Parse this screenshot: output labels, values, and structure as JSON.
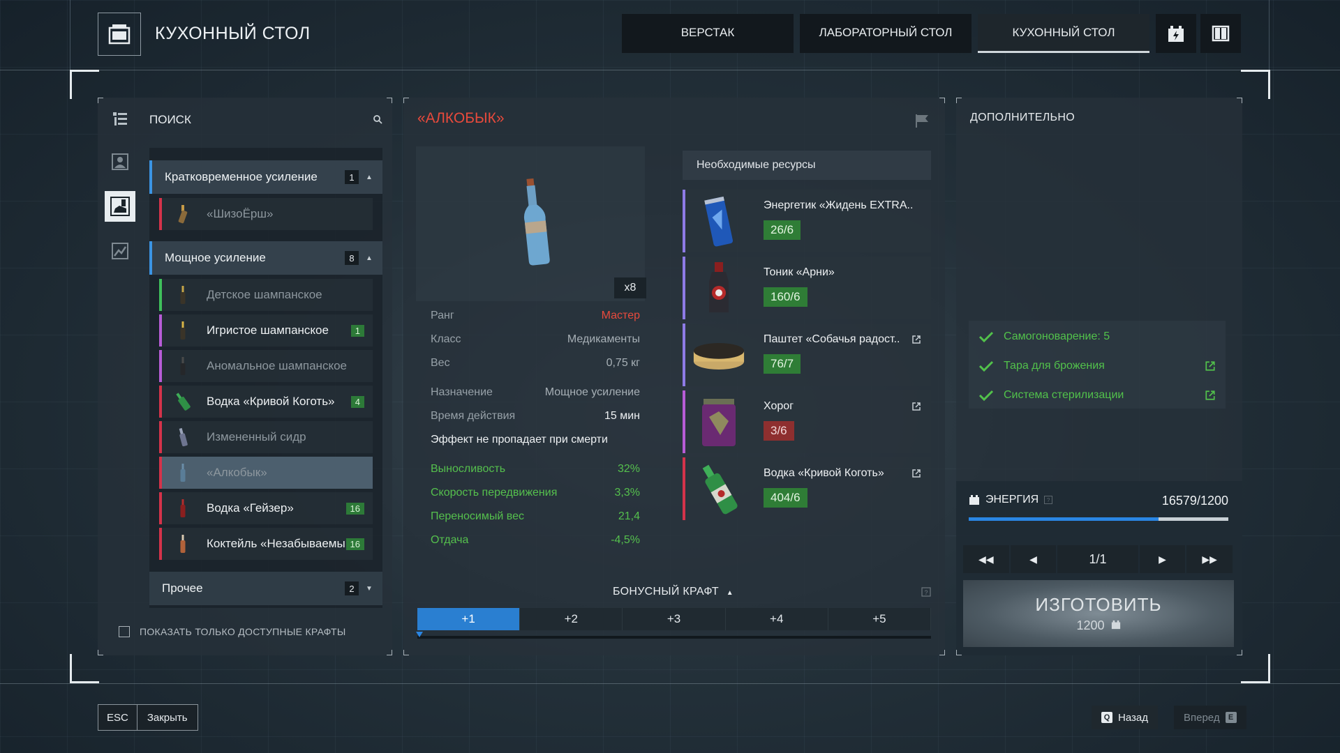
{
  "header": {
    "title": "КУХОННЫЙ СТОЛ",
    "tabs": [
      {
        "label": "ВЕРСТАК",
        "active": false
      },
      {
        "label": "ЛАБОРАТОРНЫЙ СТОЛ",
        "active": false
      },
      {
        "label": "КУХОННЫЙ СТОЛ",
        "active": true
      }
    ],
    "icons": [
      "energy-cell-icon",
      "book-icon"
    ]
  },
  "sidebar": {
    "search_label": "ПОИСК",
    "rail_icons": [
      "list-icon",
      "portrait-icon",
      "bottle-icon",
      "chart-icon"
    ],
    "categories": [
      {
        "label": "Кратковременное усиление",
        "count": "1",
        "expanded": true,
        "items": [
          {
            "name": "«ШизоЁрш»",
            "available": false,
            "qty": "",
            "color": "#d4334a"
          }
        ]
      },
      {
        "label": "Мощное усиление",
        "count": "8",
        "expanded": true,
        "items": [
          {
            "name": "Детское шампанское",
            "available": false,
            "qty": "",
            "color": "#3fbf5b"
          },
          {
            "name": "Игристое шампанское",
            "available": true,
            "qty": "1",
            "color": "#b75cd6"
          },
          {
            "name": "Аномальное шампанское",
            "available": false,
            "qty": "",
            "color": "#b75cd6"
          },
          {
            "name": "Водка «Кривой Коготь»",
            "available": true,
            "qty": "4",
            "color": "#d4334a"
          },
          {
            "name": "Измененный сидр",
            "available": false,
            "qty": "",
            "color": "#d4334a"
          },
          {
            "name": "«Алкобык»",
            "available": false,
            "qty": "",
            "color": "#d4334a",
            "selected": true
          },
          {
            "name": "Водка «Гейзер»",
            "available": true,
            "qty": "16",
            "color": "#d4334a"
          },
          {
            "name": "Коктейль «Незабываемы..",
            "available": true,
            "qty": "16",
            "color": "#d4334a"
          }
        ]
      },
      {
        "label": "Прочее",
        "count": "2",
        "expanded": false,
        "items": []
      }
    ],
    "filter_label": "ПОКАЗАТЬ ТОЛЬКО ДОСТУПНЫЕ КРАФТЫ",
    "filter_checked": false
  },
  "recipe": {
    "title": "«АЛКОБЫК»",
    "multiplier": "x8",
    "stats": [
      {
        "key": "Ранг",
        "value": "Мастер",
        "style": "red"
      },
      {
        "key": "Класс",
        "value": "Медикаменты",
        "style": "dim"
      },
      {
        "key": "Вес",
        "value": "0,75 кг",
        "style": "dim"
      },
      {
        "key": "Назначение",
        "value": "Мощное усиление",
        "style": "dim"
      },
      {
        "key": "Время действия",
        "value": "15 мин",
        "style": "white"
      }
    ],
    "note": "Эффект не пропадает при смерти",
    "effects": [
      {
        "key": "Выносливость",
        "value": "32%"
      },
      {
        "key": "Скорость передвижения",
        "value": "3,3%"
      },
      {
        "key": "Переносимый вес",
        "value": "21,4"
      },
      {
        "key": "Отдача",
        "value": "-4,5%"
      }
    ]
  },
  "resources": {
    "header": "Необходимые ресурсы",
    "items": [
      {
        "name": "Энергетик «Жидень EXTRA..",
        "count": "26/6",
        "ok": true,
        "color": "#8e7be6",
        "icon": "energy-drink-can-icon",
        "link": false
      },
      {
        "name": "Тоник «Арни»",
        "count": "160/6",
        "ok": true,
        "color": "#8e7be6",
        "icon": "tonic-bottle-icon",
        "link": false
      },
      {
        "name": "Паштет «Собачья радост..",
        "count": "76/7",
        "ok": true,
        "color": "#8e7be6",
        "icon": "pate-tin-icon",
        "link": true
      },
      {
        "name": "Хорог",
        "count": "3/6",
        "ok": false,
        "color": "#b75cd6",
        "icon": "horog-jar-icon",
        "link": true
      },
      {
        "name": "Водка «Кривой Коготь»",
        "count": "404/6",
        "ok": true,
        "color": "#d4334a",
        "icon": "vodka-bottle-icon",
        "link": true
      }
    ]
  },
  "bonus": {
    "title": "БОНУСНЫЙ КРАФТ",
    "tabs": [
      "+1",
      "+2",
      "+3",
      "+4",
      "+5"
    ],
    "active_index": 0
  },
  "extra": {
    "title": "ДОПОЛНИТЕЛЬНО",
    "requirements": [
      {
        "label": "Самогоноварение: 5",
        "link": false
      },
      {
        "label": "Тара для брожения",
        "link": true
      },
      {
        "label": "Система стерилизации",
        "link": true
      }
    ],
    "energy_label": "ЭНЕРГИЯ",
    "energy_value": "16579/1200",
    "energy_fill_fraction": 0.73,
    "page": "1/1",
    "craft_label": "ИЗГОТОВИТЬ",
    "craft_cost": "1200"
  },
  "footer": {
    "esc_key": "ESC",
    "close_label": "Закрыть",
    "back_key": "Q",
    "back_label": "Назад",
    "forward_key": "E",
    "forward_label": "Вперед"
  },
  "colors": {
    "accent_blue": "#2a86e4",
    "title_red": "#e84a3c",
    "ok_green": "#52c24b"
  }
}
